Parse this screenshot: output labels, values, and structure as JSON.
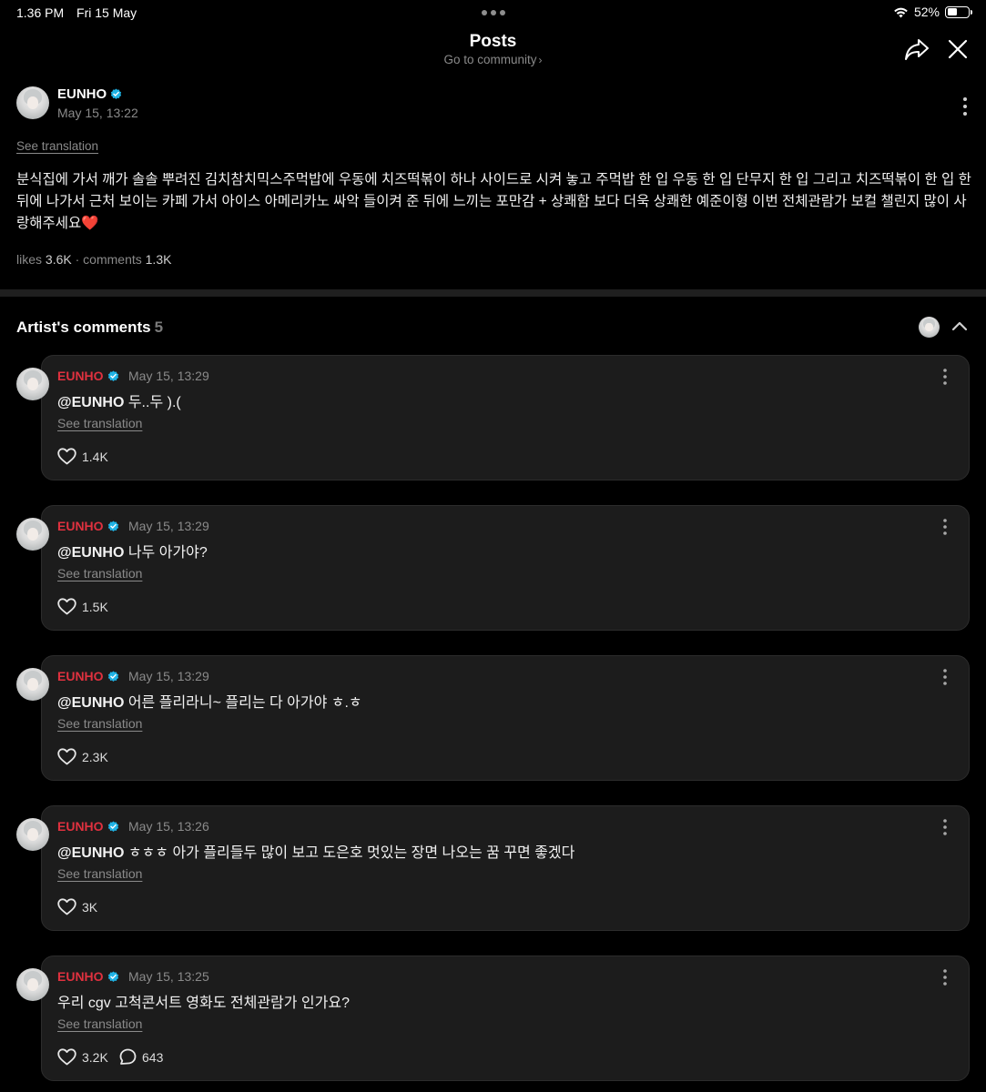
{
  "status_bar": {
    "time": "1.36 PM",
    "date": "Fri 15 May",
    "battery": "52%",
    "battery_level": 0.52,
    "icons": [
      "wifi-icon",
      "battery-icon"
    ]
  },
  "header": {
    "title": "Posts",
    "subtitle": "Go to community",
    "subtitle_chevron": "›",
    "icons": [
      "share-icon",
      "close-icon"
    ]
  },
  "post": {
    "author": "EUNHO",
    "date": "May 15, 13:22",
    "see_translation": "See translation",
    "body": "분식집에 가서 깨가 솔솔 뿌려진 김치참치믹스주먹밥에 우동에 치즈떡볶이 하나 사이드로 시켜 놓고 주먹밥 한 입 우동 한 입 단무지 한 입 그리고 치즈떡볶이 한 입 한 뒤에 나가서 근처 보이는 카페 가서 아이스 아메리카노 싸악 들이켜 준 뒤에 느끼는 포만감 + 상쾌함 보다 더욱 상쾌한 예준이형 이번 전체관람가 보컬 챌린지 많이 사랑해주세요",
    "emoji": "❤️",
    "likes_label": "likes",
    "likes": "3.6K",
    "separator": "·",
    "comments_label": "comments",
    "comments": "1.3K"
  },
  "artist_comments": {
    "title": "Artist's comments",
    "count": "5",
    "icons": [
      "chevron-up-icon"
    ]
  },
  "comments": [
    {
      "author": "EUNHO",
      "date": "May 15, 13:29",
      "mention": "@EUNHO",
      "text": " 두..두 ).(",
      "see_translation": "See translation",
      "likes": "1.4K",
      "replies": ""
    },
    {
      "author": "EUNHO",
      "date": "May 15, 13:29",
      "mention": "@EUNHO",
      "text": " 나두 아가야?",
      "see_translation": "See translation",
      "likes": "1.5K",
      "replies": ""
    },
    {
      "author": "EUNHO",
      "date": "May 15, 13:29",
      "mention": "@EUNHO",
      "text": " 어른 플리라니~ 플리는 다 아가야 ㅎ.ㅎ",
      "see_translation": "See translation",
      "likes": "2.3K",
      "replies": ""
    },
    {
      "author": "EUNHO",
      "date": "May 15, 13:26",
      "mention": "@EUNHO",
      "text": " ㅎㅎㅎ 아가 플리들두 많이 보고 도은호 멋있는 장면 나오는 꿈 꾸면 좋겠다",
      "see_translation": "See translation",
      "likes": "3K",
      "replies": ""
    },
    {
      "author": "EUNHO",
      "date": "May 15, 13:25",
      "mention": "",
      "text": "우리 cgv 고척콘서트 영화도 전체관람가 인가요?",
      "see_translation": "See translation",
      "likes": "3.2K",
      "replies": "643"
    }
  ],
  "colors": {
    "background": "#000000",
    "card": "#1c1c1c",
    "artist_name": "#e0313f",
    "verified": "#1fb3e5",
    "muted": "#8a8a8a"
  }
}
